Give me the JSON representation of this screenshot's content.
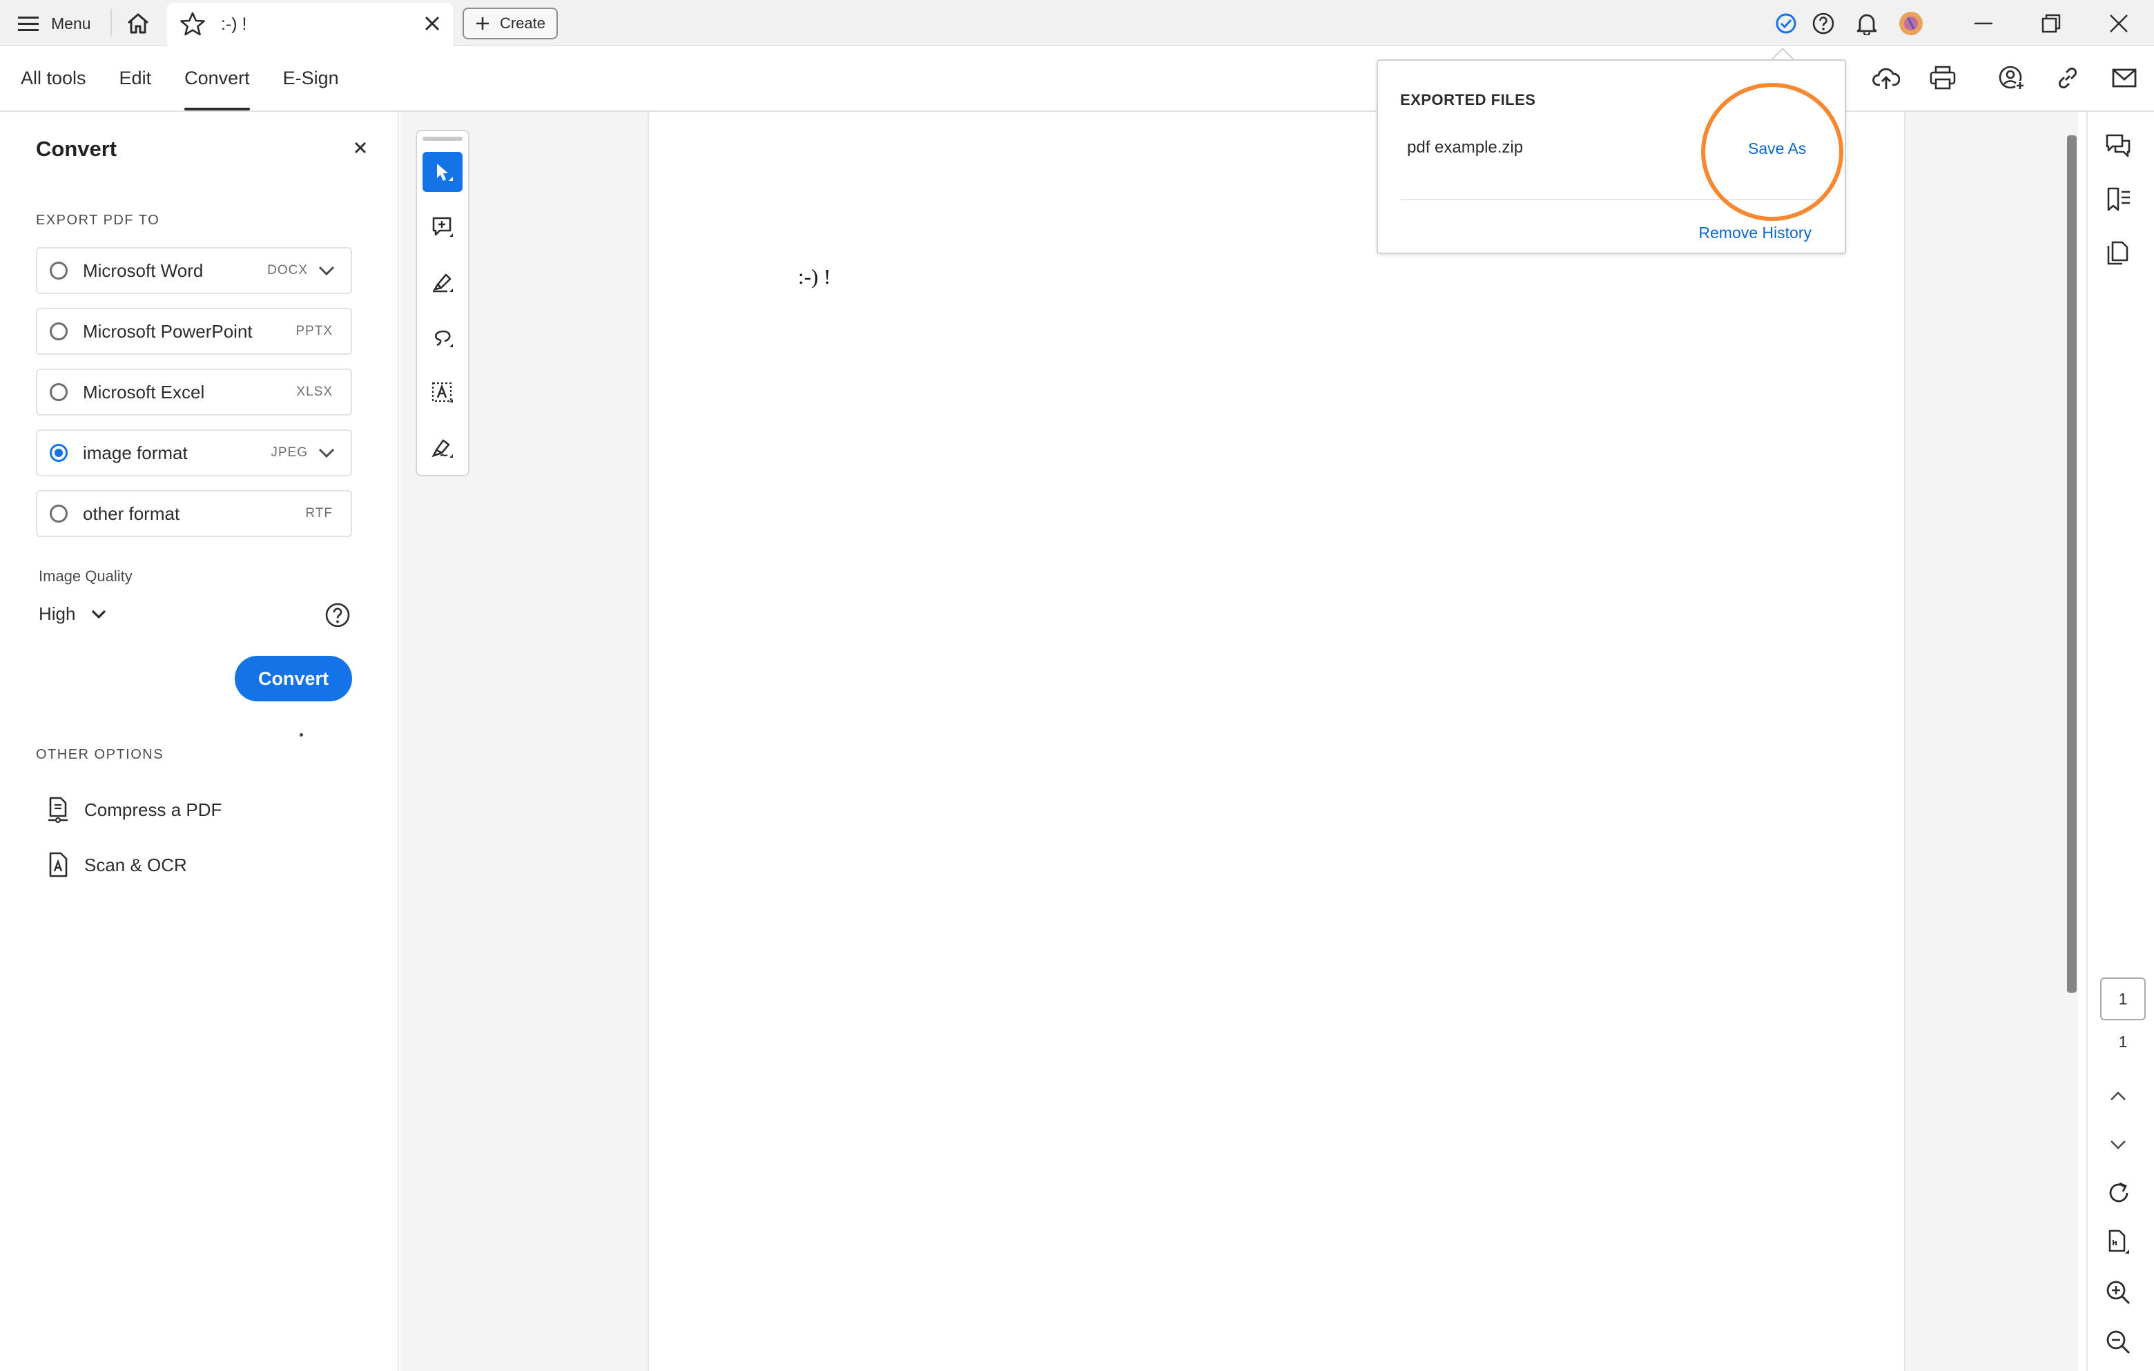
{
  "titlebar": {
    "menu_label": "Menu",
    "tab_title": ":-) !",
    "create_label": "Create"
  },
  "toolbar": {
    "tabs": [
      {
        "label": "All tools"
      },
      {
        "label": "Edit"
      },
      {
        "label": "Convert"
      },
      {
        "label": "E-Sign"
      }
    ],
    "active_tab": "Convert"
  },
  "panel": {
    "title": "Convert",
    "export_heading": "EXPORT PDF TO",
    "options": [
      {
        "label": "Microsoft Word",
        "ext": "DOCX",
        "selected": false,
        "has_dropdown": true
      },
      {
        "label": "Microsoft PowerPoint",
        "ext": "PPTX",
        "selected": false,
        "has_dropdown": false
      },
      {
        "label": "Microsoft Excel",
        "ext": "XLSX",
        "selected": false,
        "has_dropdown": false
      },
      {
        "label": "image format",
        "ext": "JPEG",
        "selected": true,
        "has_dropdown": true
      },
      {
        "label": "other format",
        "ext": "RTF",
        "selected": false,
        "has_dropdown": false
      }
    ],
    "quality_label": "Image Quality",
    "quality_value": "High",
    "convert_label": "Convert",
    "other_heading": "OTHER OPTIONS",
    "other_options": [
      {
        "label": "Compress a PDF"
      },
      {
        "label": "Scan & OCR"
      }
    ]
  },
  "document": {
    "text": ":-) !"
  },
  "pager": {
    "current": "1",
    "total": "1"
  },
  "popup": {
    "title": "EXPORTED FILES",
    "file_name": "pdf example.zip",
    "save_as": "Save As",
    "remove_history": "Remove History"
  },
  "colors": {
    "accent": "#1473e6",
    "link": "#0d66d0",
    "highlight": "#f7882f"
  }
}
